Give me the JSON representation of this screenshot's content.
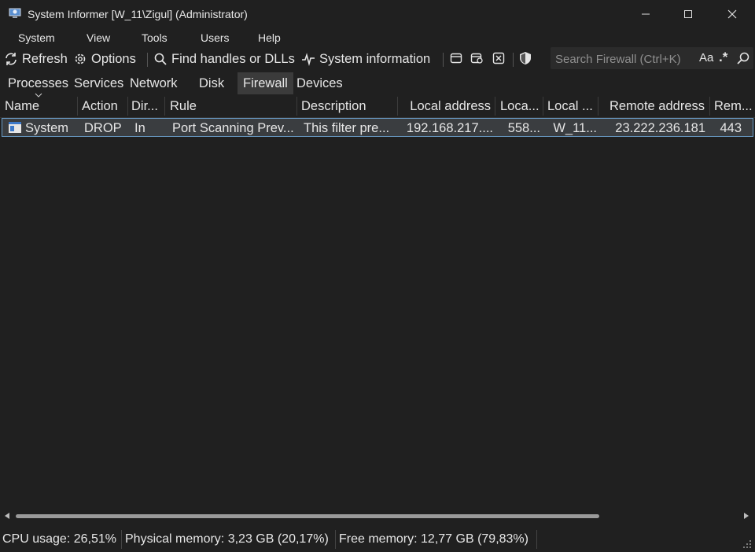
{
  "window": {
    "title": "System Informer [W_11\\Zigul] (Administrator)"
  },
  "menu": [
    "System",
    "View",
    "Tools",
    "Users",
    "Help"
  ],
  "toolbar": {
    "refresh": "Refresh",
    "options": "Options",
    "find_handles": "Find handles or DLLs",
    "system_information": "System information"
  },
  "search": {
    "placeholder": "Search Firewall (Ctrl+K)",
    "case_label": "Aa",
    "regex_label": ".*"
  },
  "tabs": [
    "Processes",
    "Services",
    "Network",
    "Disk",
    "Firewall",
    "Devices"
  ],
  "active_tab": "Firewall",
  "columns": [
    "Name",
    "Action",
    "Dir...",
    "Rule",
    "Description",
    "Local address",
    "Loca...",
    "Local ...",
    "Remote address",
    "Rem..."
  ],
  "rows": [
    {
      "name": "System",
      "action": "DROP",
      "direction": "In",
      "rule": "Port Scanning Prev...",
      "description": "This filter pre...",
      "local_address": "192.168.217....",
      "local_port": "558...",
      "local_hostname": "W_11...",
      "remote_address": "23.222.236.181",
      "remote_port": "443"
    }
  ],
  "status": {
    "cpu": "CPU usage: 26,51%",
    "physical_memory": "Physical memory: 3,23 GB (20,17%)",
    "free_memory": "Free memory: 12,77 GB (79,83%)"
  }
}
